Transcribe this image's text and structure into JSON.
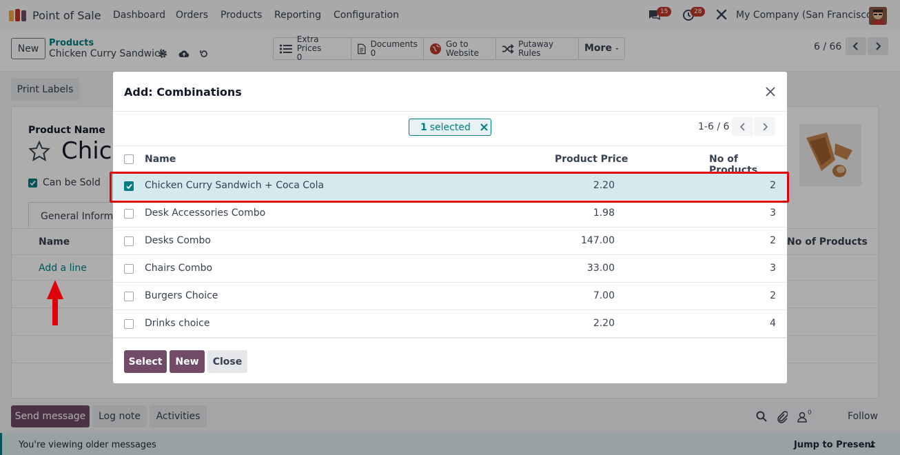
{
  "navbar": {
    "app_name": "Point of Sale",
    "menu": [
      "Dashboard",
      "Orders",
      "Products",
      "Reporting",
      "Configuration"
    ],
    "messages_count": "15",
    "activities_count": "28",
    "company": "My Company (San Francisco)"
  },
  "control_panel": {
    "new_label": "New",
    "breadcrumb_parent": "Products",
    "breadcrumb_current": "Chicken Curry Sandwich",
    "smart_buttons": {
      "extra_prices_label": "Extra Prices",
      "extra_prices_count": "0",
      "documents_label": "Documents",
      "documents_count": "0",
      "go_to_line1": "Go to",
      "go_to_line2": "Website",
      "putaway_label": "Putaway Rules",
      "more_label": "More"
    },
    "pager": "6 / 66"
  },
  "form": {
    "print_labels": "Print Labels",
    "product_name_label": "Product Name",
    "product_name_partial": "Chick",
    "can_be_sold": "Can be Sold",
    "tab_general": "General Informat",
    "col_name": "Name",
    "col_no_products": "No of Products",
    "add_line": "Add a line"
  },
  "chatter": {
    "send_message": "Send message",
    "log_note": "Log note",
    "activities": "Activities",
    "followers_count": "0",
    "follow": "Follow",
    "older_messages": "You're viewing older messages",
    "jump_to_present": "Jump to Present"
  },
  "modal": {
    "title": "Add: Combinations",
    "selected_count": "1",
    "selected_label": "selected",
    "pager": "1-6 / 6",
    "columns": {
      "name": "Name",
      "price": "Product Price",
      "count": "No of Products"
    },
    "rows": [
      {
        "name": "Chicken Curry Sandwich + Coca Cola",
        "price": "2.20",
        "count": "2",
        "checked": true
      },
      {
        "name": "Desk Accessories Combo",
        "price": "1.98",
        "count": "3",
        "checked": false
      },
      {
        "name": "Desks Combo",
        "price": "147.00",
        "count": "2",
        "checked": false
      },
      {
        "name": "Chairs Combo",
        "price": "33.00",
        "count": "3",
        "checked": false
      },
      {
        "name": "Burgers Choice",
        "price": "7.00",
        "count": "2",
        "checked": false
      },
      {
        "name": "Drinks choice",
        "price": "2.20",
        "count": "4",
        "checked": false
      }
    ],
    "buttons": {
      "select": "Select",
      "new": "New",
      "close": "Close"
    }
  },
  "colors": {
    "brand": "#714b67",
    "accent": "#017e84",
    "highlight": "#e0000a",
    "selected_row": "#d4eaee"
  }
}
